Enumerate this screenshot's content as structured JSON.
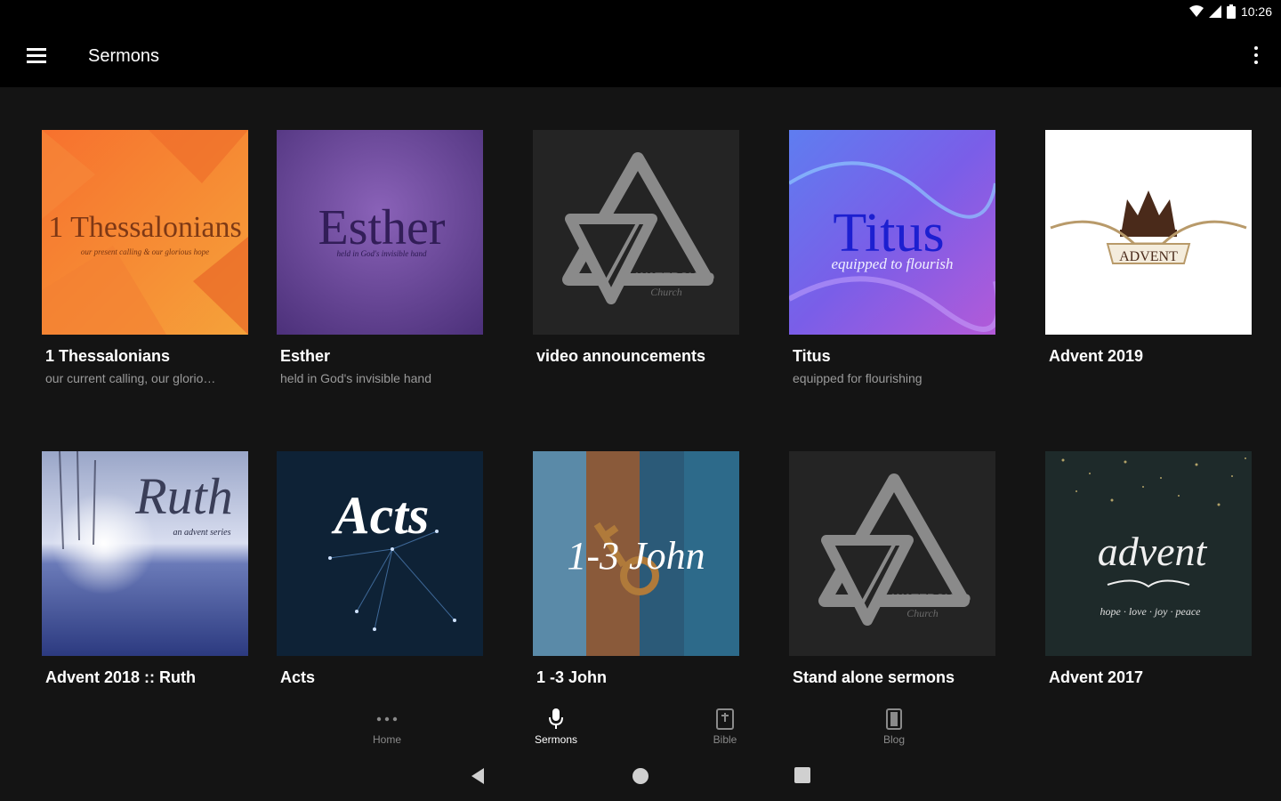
{
  "status": {
    "time": "10:26"
  },
  "appbar": {
    "title": "Sermons"
  },
  "series": [
    {
      "title": "1 Thessalonians",
      "subtitle": "our current calling, our glorio…",
      "art_text": "1 Thessalonians",
      "art_sub": "our present calling & our glorious hope"
    },
    {
      "title": "Esther",
      "subtitle": "held in God's invisible hand",
      "art_text": "Esther",
      "art_sub": "held in God's invisible hand"
    },
    {
      "title": "video announcements",
      "subtitle": "",
      "art_text": "WATERSHED",
      "art_sub": "Church"
    },
    {
      "title": "Titus",
      "subtitle": "equipped for flourishing",
      "art_text": "Titus",
      "art_sub": "equipped to flourish"
    },
    {
      "title": "Advent 2019",
      "subtitle": "",
      "art_text": "ADVENT",
      "art_sub": ""
    },
    {
      "title": "Advent 2018 :: Ruth",
      "subtitle": "",
      "art_text": "Ruth",
      "art_sub": "an advent series"
    },
    {
      "title": "Acts",
      "subtitle": "",
      "art_text": "Acts",
      "art_sub": ""
    },
    {
      "title": "1 -3 John",
      "subtitle": "",
      "art_text": "1-3 John",
      "art_sub": ""
    },
    {
      "title": "Stand alone sermons",
      "subtitle": "",
      "art_text": "WATERSHED",
      "art_sub": "Church"
    },
    {
      "title": "Advent 2017",
      "subtitle": "",
      "art_text": "advent",
      "art_sub": "hope · love · joy · peace"
    }
  ],
  "bottom_nav": [
    {
      "label": "Home",
      "icon": "more-horizontal-icon",
      "active": false
    },
    {
      "label": "Sermons",
      "icon": "microphone-icon",
      "active": true
    },
    {
      "label": "Bible",
      "icon": "bible-icon",
      "active": false
    },
    {
      "label": "Blog",
      "icon": "blog-icon",
      "active": false
    }
  ],
  "colors": {
    "background": "#141414",
    "appbar": "#000000",
    "inactive": "#8a8a8a"
  }
}
